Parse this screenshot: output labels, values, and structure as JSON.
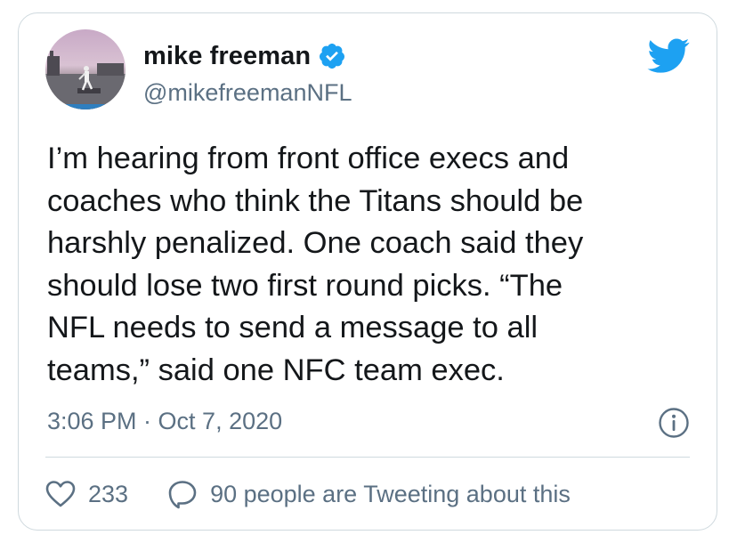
{
  "author": {
    "display_name": "mike freeman",
    "handle": "@mikefreemanNFL",
    "verified": true,
    "verified_icon": "verified-badge-icon",
    "avatar_icon": "profile-photo"
  },
  "brand": {
    "logo_icon": "twitter-bird-icon",
    "accent_color": "#1da1f2"
  },
  "tweet": {
    "lines": [
      "I’m hearing from front office execs and",
      "coaches who think the Titans should be",
      "harshly penalized. One coach said they",
      "should lose two first round picks. “The",
      "NFL needs to send a message to all",
      "teams,” said one NFC team exec."
    ],
    "timestamp": "3:06 PM · Oct 7, 2020"
  },
  "actions": {
    "like_count": "233",
    "reply_text": "90 people are Tweeting about this",
    "like_icon": "heart-icon",
    "reply_icon": "speech-bubble-icon",
    "info_icon": "info-icon"
  },
  "colors": {
    "text_primary": "#14171a",
    "text_secondary": "#5b7083",
    "border": "#cfd9de"
  }
}
